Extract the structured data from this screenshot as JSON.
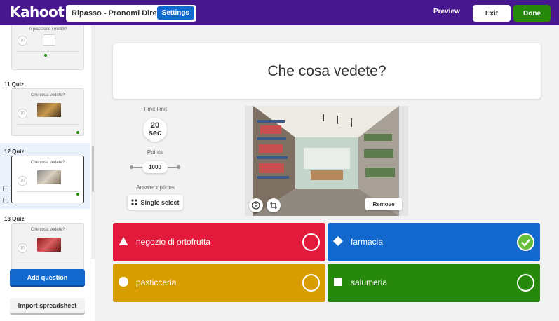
{
  "app": {
    "logo_text": "Kahoot!",
    "quiz_title": "Ripasso - Pronomi Diretti",
    "settings_label": "Settings",
    "preview_label": "Preview",
    "exit_label": "Exit",
    "done_label": "Done"
  },
  "sidebar": {
    "slides": [
      {
        "number_label": "",
        "question": "Ti piacciono i mirtilli?",
        "has_image": false
      },
      {
        "number_label": "11  Quiz",
        "question": "Che cosa vedete?",
        "has_image": true
      },
      {
        "number_label": "12  Quiz",
        "question": "Che cosa vedete?",
        "has_image": true,
        "selected": true
      },
      {
        "number_label": "13  Quiz",
        "question": "Che cosa vedete?",
        "has_image": true
      }
    ],
    "thumb_circle_text": "20",
    "add_question_label": "Add question",
    "import_label": "Import spreadsheet"
  },
  "question": {
    "text": "Che cosa vedete?"
  },
  "settings": {
    "time_limit_label": "Time limit",
    "time_value": "20",
    "time_unit": "sec",
    "points_label": "Points",
    "points_value": "1000",
    "answer_options_label": "Answer options",
    "answer_type": "Single select"
  },
  "media": {
    "remove_label": "Remove"
  },
  "answers": [
    {
      "text": "negozio di ortofrutta",
      "color": "#e21b3c",
      "shape": "triangle",
      "correct": false
    },
    {
      "text": "farmacia",
      "color": "#1368ce",
      "shape": "diamond",
      "correct": true
    },
    {
      "text": "pasticceria",
      "color": "#d89e00",
      "shape": "circle",
      "correct": false
    },
    {
      "text": "salumeria",
      "color": "#26890c",
      "shape": "square",
      "correct": false
    }
  ]
}
